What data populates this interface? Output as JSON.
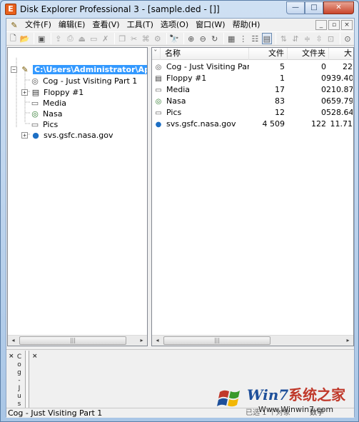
{
  "window": {
    "title": "Disk Explorer Professional 3 - [sample.ded - []]",
    "app_icon": "E",
    "buttons": {
      "minimize": "—",
      "maximize": "□",
      "close": "✕"
    }
  },
  "menubar": {
    "items": [
      "文件(F)",
      "编辑(E)",
      "查看(V)",
      "工具(T)",
      "选项(O)",
      "窗口(W)",
      "帮助(H)"
    ],
    "mdi": {
      "minimize": "_",
      "restore": "▫",
      "close": "×"
    }
  },
  "toolbar": {
    "buttons": [
      {
        "icon": "new-icon",
        "glyph": "🗋"
      },
      {
        "icon": "open-icon",
        "glyph": "📂"
      },
      {
        "icon": "catalog-icon",
        "glyph": "▣"
      },
      {
        "icon": "import-icon",
        "glyph": "⇪"
      },
      {
        "icon": "export-icon",
        "glyph": "⎙"
      },
      {
        "icon": "eject-icon",
        "glyph": "⏏"
      },
      {
        "icon": "drive-icon",
        "glyph": "▭"
      },
      {
        "icon": "delete-icon",
        "glyph": "✗"
      },
      {
        "icon": "copy-icon",
        "glyph": "❐"
      },
      {
        "icon": "cut-icon",
        "glyph": "✂"
      },
      {
        "icon": "paste-icon",
        "glyph": "⌘"
      },
      {
        "icon": "properties-icon",
        "glyph": "⚙"
      },
      {
        "icon": "find-icon",
        "glyph": "🔭"
      },
      {
        "icon": "disk-add-icon",
        "glyph": "⊕"
      },
      {
        "icon": "disk-remove-icon",
        "glyph": "⊖"
      },
      {
        "icon": "disk-update-icon",
        "glyph": "↻"
      },
      {
        "icon": "large-icons-icon",
        "glyph": "▦"
      },
      {
        "icon": "tree-view-icon",
        "glyph": "⋮"
      },
      {
        "icon": "list-view-icon",
        "glyph": "☷"
      },
      {
        "icon": "details-view-icon",
        "glyph": "▤"
      },
      {
        "icon": "sort-az-icon",
        "glyph": "⇅"
      },
      {
        "icon": "sort-za-icon",
        "glyph": "⇵"
      },
      {
        "icon": "sort-size-icon",
        "glyph": "≑"
      },
      {
        "icon": "sort-date-icon",
        "glyph": "⇳"
      },
      {
        "icon": "info-icon",
        "glyph": "⊡"
      },
      {
        "icon": "options-icon",
        "glyph": "⊙"
      }
    ]
  },
  "tree": {
    "root": "C:\\Users\\Administrator\\AppData\\",
    "items": [
      {
        "label": "Cog - Just Visiting Part 1",
        "icon": "cd-audio-icon",
        "glyph": "◎",
        "expandable": false
      },
      {
        "label": "Floppy #1",
        "icon": "floppy-icon",
        "glyph": "▤",
        "expandable": true
      },
      {
        "label": "Media",
        "icon": "drive-icon",
        "glyph": "▭",
        "expandable": false
      },
      {
        "label": "Nasa",
        "icon": "cd-icon",
        "glyph": "◎",
        "expandable": false
      },
      {
        "label": "Pics",
        "icon": "drive-icon",
        "glyph": "▭",
        "expandable": false
      },
      {
        "label": "svs.gsfc.nasa.gov",
        "icon": "globe-icon",
        "glyph": "●",
        "expandable": true
      }
    ]
  },
  "list": {
    "sort_indicator": "ˇ",
    "columns": [
      "名称",
      "文件",
      "文件夹",
      "大"
    ],
    "rows": [
      {
        "name": "Cog - Just Visiting Part 1",
        "icon": "cd-audio-icon",
        "glyph": "◎",
        "files": "5",
        "folders": "0",
        "size": "22"
      },
      {
        "name": "Floppy #1",
        "icon": "floppy-icon",
        "glyph": "▤",
        "files": "1",
        "folders": "0",
        "size": "939.40"
      },
      {
        "name": "Media",
        "icon": "drive-icon",
        "glyph": "▭",
        "files": "17",
        "folders": "0",
        "size": "210.87"
      },
      {
        "name": "Nasa",
        "icon": "cd-icon",
        "glyph": "◎",
        "files": "83",
        "folders": "0",
        "size": "659.79"
      },
      {
        "name": "Pics",
        "icon": "drive-icon",
        "glyph": "▭",
        "files": "12",
        "folders": "0",
        "size": "528.64"
      },
      {
        "name": "svs.gsfc.nasa.gov",
        "icon": "globe-icon",
        "glyph": "●",
        "files": "4 509",
        "folders": "122",
        "size": "11.71"
      }
    ]
  },
  "scrollbars": {
    "left": "◂",
    "right": "▸",
    "grip": "|||"
  },
  "bottom": {
    "close_left": "×",
    "close_right": "×",
    "vertical_label": "Cog - Just",
    "vertical_chars": [
      "C",
      "o",
      "g",
      "-",
      "J",
      "u",
      "s",
      "t"
    ]
  },
  "statusbar": {
    "text": "Cog - Just Visiting Part 1",
    "middle": "已选 1 个对象",
    "right": "数字"
  },
  "watermark": {
    "brand_latin": "Win7",
    "brand_cn": "系统之家",
    "url": "Www.Winwin7.com",
    "colors": {
      "blue": "#1e4f9a",
      "red": "#c0392b",
      "green": "#3a9a2a",
      "yellow": "#f2b705"
    }
  },
  "colors": {
    "selection": "#3399ff",
    "title_gradient_top": "#cfe0f3",
    "close_button": "#c9452b"
  }
}
